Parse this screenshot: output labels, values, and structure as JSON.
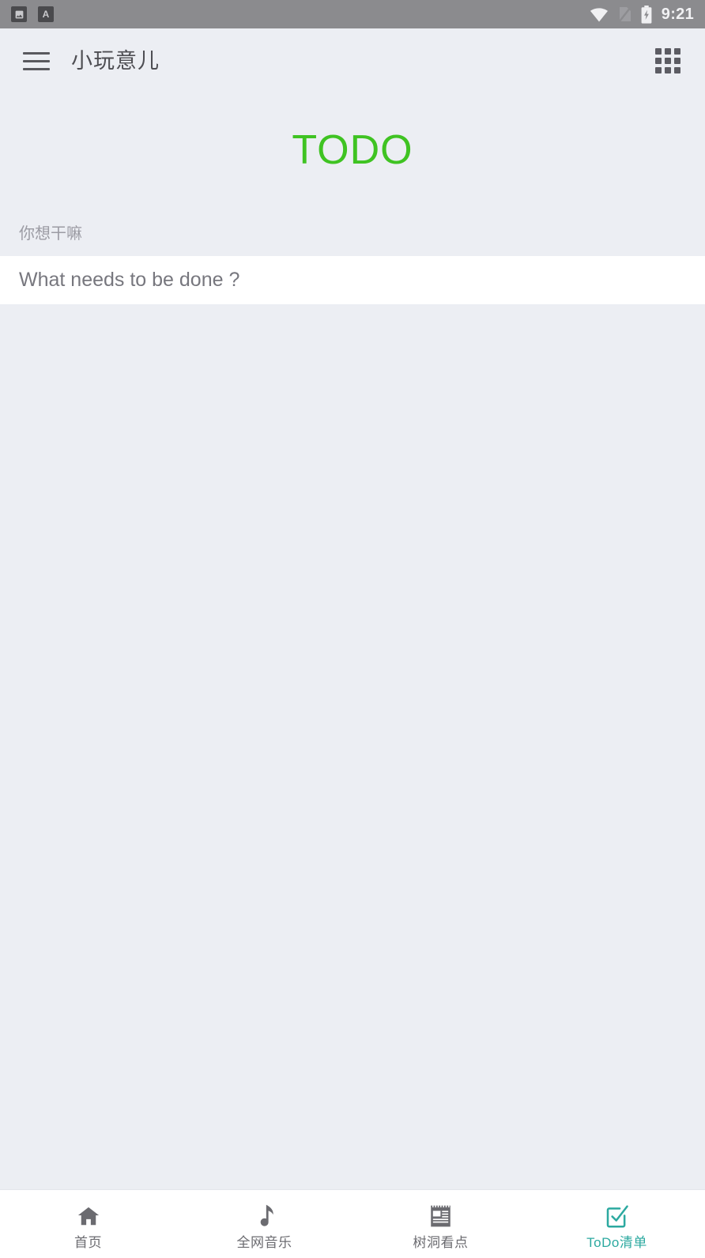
{
  "status_bar": {
    "time": "9:21",
    "notifications": [
      {
        "name": "image-notification-icon",
        "glyph": "image"
      },
      {
        "name": "font-notification-icon",
        "glyph": "A"
      }
    ],
    "indicators": [
      {
        "name": "wifi-icon"
      },
      {
        "name": "no-sim-icon"
      },
      {
        "name": "battery-charging-icon"
      }
    ],
    "background_color": "#8b8b8e"
  },
  "app_bar": {
    "menu_icon": "hamburger-menu-icon",
    "title": "小玩意儿",
    "apps_icon": "apps-grid-icon"
  },
  "content": {
    "heading": "TODO",
    "heading_color": "#3fc322",
    "field_label": "你想干嘛",
    "input_value": "",
    "input_placeholder": "What needs to be done ?",
    "todo_items": []
  },
  "bottom_nav": {
    "active_color": "#2ca9a0",
    "inactive_color": "#6b6b70",
    "items": [
      {
        "label": "首页",
        "icon": "home-icon",
        "active": false
      },
      {
        "label": "全网音乐",
        "icon": "music-note-icon",
        "active": false
      },
      {
        "label": "树洞看点",
        "icon": "notepad-icon",
        "active": false
      },
      {
        "label": "ToDo清单",
        "icon": "checklist-icon",
        "active": true
      }
    ]
  }
}
